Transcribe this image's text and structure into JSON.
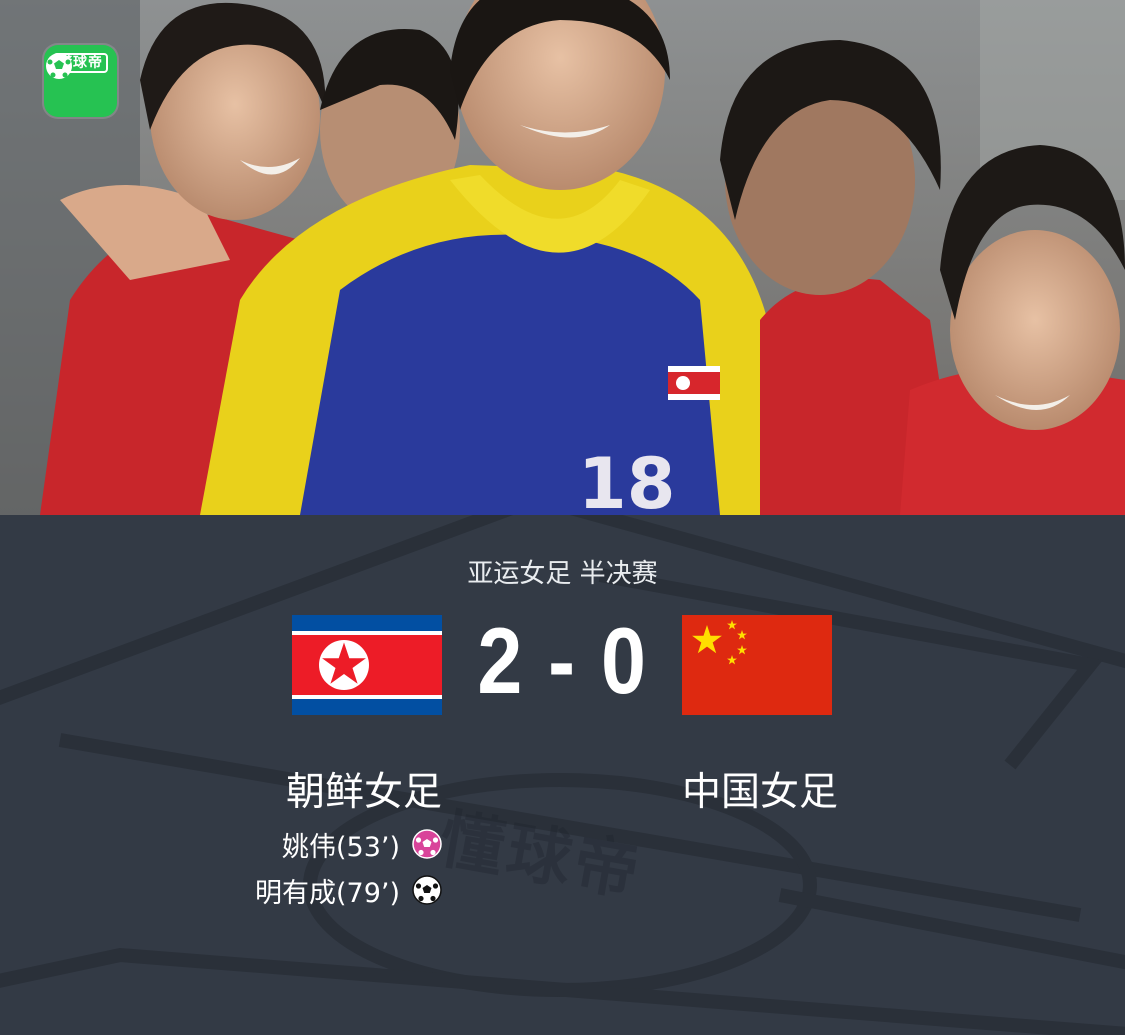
{
  "app": {
    "logo_text": "懂球帝",
    "watermark_text": "懂球帝"
  },
  "match": {
    "competition": "亚运女足 半决赛",
    "score": "2 - 0",
    "home": {
      "name": "朝鲜女足"
    },
    "away": {
      "name": "中国女足"
    },
    "scorers": [
      {
        "name": "姚伟(53’)",
        "icon": "own-goal-ball-icon",
        "color": "#d9449a"
      },
      {
        "name": "明有成(79’)",
        "icon": "soccer-ball-icon",
        "color": "#ffffff"
      }
    ]
  },
  "colors": {
    "panel_bg": "#333a45",
    "logo_green": "#26c252",
    "dprk_red": "#ed1c27",
    "dprk_blue": "#024fa2",
    "china_red": "#de2910",
    "china_yellow": "#ffde00"
  }
}
